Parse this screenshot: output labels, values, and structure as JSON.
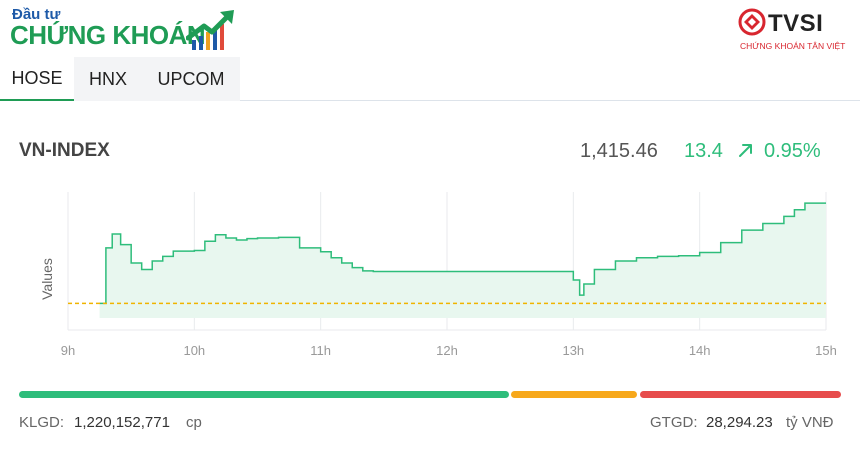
{
  "header": {
    "logo_top": "Đầu tư",
    "logo_main": "CHỨNG KHOÁN",
    "partner_name": "TVSI",
    "partner_sub": "CHỨNG KHOÁN TÂN VIỆT"
  },
  "tabs": [
    {
      "label": "HOSE",
      "active": true
    },
    {
      "label": "HNX",
      "active": false
    },
    {
      "label": "UPCOM",
      "active": false
    }
  ],
  "index": {
    "name": "VN-INDEX",
    "value": "1,415.46",
    "change": "13.4",
    "change_pct": "0.95%",
    "direction": "up"
  },
  "chart_data": {
    "type": "area",
    "ylabel": "Values",
    "x_ticks": [
      "9h",
      "10h",
      "11h",
      "12h",
      "13h",
      "14h",
      "15h"
    ],
    "reference_value": 1402.06,
    "ylim": [
      1398,
      1419
    ],
    "series": [
      {
        "x": [
          "9:15",
          "9:18",
          "9:21",
          "9:25",
          "9:30",
          "9:35",
          "9:40",
          "9:45",
          "9:50",
          "9:55",
          "10:00",
          "10:05",
          "10:10",
          "10:15",
          "10:20",
          "10:25",
          "10:30",
          "10:40",
          "10:50",
          "11:00",
          "11:05",
          "11:10",
          "11:15",
          "11:20",
          "11:25",
          "11:30",
          "13:00",
          "13:03",
          "13:05",
          "13:10",
          "13:20",
          "13:30",
          "13:40",
          "13:50",
          "14:00",
          "14:10",
          "14:20",
          "14:30",
          "14:40",
          "14:45",
          "14:50",
          "15:00"
        ],
        "values": [
          1402.06,
          1410.5,
          1412.6,
          1411.0,
          1408.2,
          1407.2,
          1408.5,
          1409.2,
          1410.0,
          1410.0,
          1410.1,
          1411.5,
          1412.5,
          1412.0,
          1411.7,
          1411.9,
          1412.0,
          1412.1,
          1410.5,
          1409.9,
          1409.0,
          1408.2,
          1407.5,
          1407.0,
          1406.9,
          1406.9,
          1405.6,
          1403.3,
          1405.0,
          1407.2,
          1408.5,
          1409.0,
          1409.2,
          1409.3,
          1409.8,
          1411.3,
          1413.2,
          1414.2,
          1415.3,
          1416.3,
          1417.3,
          1417.3
        ]
      }
    ],
    "colors": {
      "line": "#2ebd7b",
      "fill": "#e8f7ef",
      "reference": "#f0b400"
    }
  },
  "breadth": {
    "colors": {
      "up": "#2ebd7b",
      "unchanged": "#f7a81b",
      "down": "#e74c4c"
    }
  },
  "stats": {
    "volume_label": "KLGD:",
    "volume_value": "1,220,152,771",
    "volume_unit": "cp",
    "value_label": "GTGD:",
    "value_value": "28,294.23",
    "value_unit": "tỷ VNĐ"
  }
}
